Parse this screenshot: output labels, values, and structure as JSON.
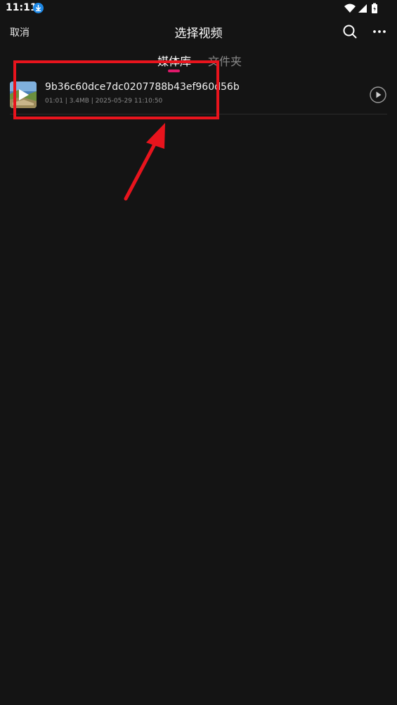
{
  "status_bar": {
    "time": "11:11",
    "icons": [
      "download-icon",
      "wifi-icon",
      "signal-icon",
      "battery-icon"
    ]
  },
  "header": {
    "cancel_label": "取消",
    "title": "选择视频",
    "actions": [
      "search-icon",
      "more-icon"
    ]
  },
  "tabs": [
    {
      "label": "媒体库",
      "active": true
    },
    {
      "label": "文件夹",
      "active": false
    }
  ],
  "videos": [
    {
      "name": "9b36c60dce7dc0207788b43ef960d56b",
      "meta": "01:01 | 3.4MB | 2025-05-29 11:10:50"
    }
  ],
  "colors": {
    "background": "#141414",
    "accent": "#e0196b",
    "annotation": "#e8141d",
    "muted_text": "#8a8a8a"
  }
}
